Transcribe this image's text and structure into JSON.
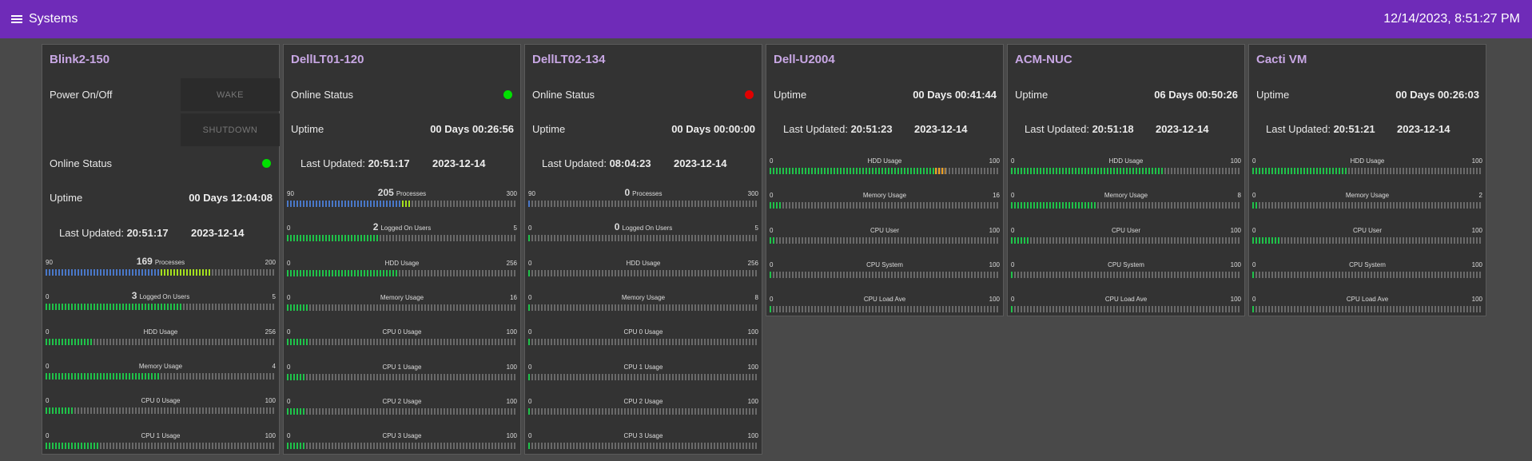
{
  "header": {
    "title": "Systems",
    "datetime": "12/14/2023, 8:51:27 PM",
    "menu_icon": "hamburger-menu-icon"
  },
  "colors": {
    "header_bg": "#6f2bb8",
    "card_bg": "#333333",
    "title": "#c8a7e4",
    "online_green": "#00e000",
    "offline_red": "#e00000",
    "bar_green": "#1fc34a",
    "bar_blue": "#4a78c8",
    "bar_lime": "#a5e01e",
    "bar_orange": "#f0a020"
  },
  "cards": [
    {
      "name": "Blink2-150",
      "power_label": "Power On/Off",
      "wake_label": "WAKE",
      "shutdown_label": "SHUTDOWN",
      "online_label": "Online Status",
      "online": true,
      "uptime_label": "Uptime",
      "uptime": "00 Days 12:04:08",
      "last_updated_label": "Last Updated:",
      "last_updated_time": "20:51:17",
      "last_updated_date": "2023-12-14",
      "gauges": [
        {
          "title": "Processes",
          "value_text": "169",
          "min": "90",
          "max": "200",
          "value": 169,
          "lo": 90,
          "hi": 200,
          "style": "process"
        },
        {
          "title": "Logged On Users",
          "value_text": "3",
          "min": "0",
          "max": "5",
          "value": 3,
          "lo": 0,
          "hi": 5,
          "style": "green"
        },
        {
          "title": "HDD Usage",
          "min": "0",
          "max": "256",
          "value": 52,
          "lo": 0,
          "hi": 256,
          "style": "green"
        },
        {
          "title": "Memory Usage",
          "min": "0",
          "max": "4",
          "value": 2.0,
          "lo": 0,
          "hi": 4,
          "style": "green"
        },
        {
          "title": "CPU 0 Usage",
          "min": "0",
          "max": "100",
          "value": 12,
          "lo": 0,
          "hi": 100,
          "style": "green"
        },
        {
          "title": "CPU 1 Usage",
          "min": "0",
          "max": "100",
          "value": 24,
          "lo": 0,
          "hi": 100,
          "style": "green"
        }
      ]
    },
    {
      "name": "DellLT01-120",
      "online_label": "Online Status",
      "online": true,
      "uptime_label": "Uptime",
      "uptime": "00 Days 00:26:56",
      "last_updated_label": "Last Updated:",
      "last_updated_time": "20:51:17",
      "last_updated_date": "2023-12-14",
      "gauges": [
        {
          "title": "Processes",
          "value_text": "205",
          "min": "90",
          "max": "300",
          "value": 205,
          "lo": 90,
          "hi": 300,
          "style": "process"
        },
        {
          "title": "Logged On Users",
          "value_text": "2",
          "min": "0",
          "max": "5",
          "value": 2,
          "lo": 0,
          "hi": 5,
          "style": "green"
        },
        {
          "title": "HDD Usage",
          "min": "0",
          "max": "256",
          "value": 125,
          "lo": 0,
          "hi": 256,
          "style": "green"
        },
        {
          "title": "Memory Usage",
          "min": "0",
          "max": "16",
          "value": 1.5,
          "lo": 0,
          "hi": 16,
          "style": "green"
        },
        {
          "title": "CPU 0 Usage",
          "min": "0",
          "max": "100",
          "value": 10,
          "lo": 0,
          "hi": 100,
          "style": "green"
        },
        {
          "title": "CPU 1 Usage",
          "min": "0",
          "max": "100",
          "value": 9,
          "lo": 0,
          "hi": 100,
          "style": "green"
        },
        {
          "title": "CPU 2 Usage",
          "min": "0",
          "max": "100",
          "value": 9,
          "lo": 0,
          "hi": 100,
          "style": "green"
        },
        {
          "title": "CPU 3 Usage",
          "min": "0",
          "max": "100",
          "value": 9,
          "lo": 0,
          "hi": 100,
          "style": "green"
        }
      ]
    },
    {
      "name": "DellLT02-134",
      "online_label": "Online Status",
      "online": false,
      "uptime_label": "Uptime",
      "uptime": "00 Days 00:00:00",
      "last_updated_label": "Last Updated:",
      "last_updated_time": "08:04:23",
      "last_updated_date": "2023-12-14",
      "gauges": [
        {
          "title": "Processes",
          "value_text": "0",
          "min": "90",
          "max": "300",
          "value": 0,
          "lo": 90,
          "hi": 300,
          "style": "process"
        },
        {
          "title": "Logged On Users",
          "value_text": "0",
          "min": "0",
          "max": "5",
          "value": 0,
          "lo": 0,
          "hi": 5,
          "style": "green"
        },
        {
          "title": "HDD Usage",
          "min": "0",
          "max": "256",
          "value": 0,
          "lo": 0,
          "hi": 256,
          "style": "green"
        },
        {
          "title": "Memory Usage",
          "min": "0",
          "max": "8",
          "value": 0,
          "lo": 0,
          "hi": 8,
          "style": "green"
        },
        {
          "title": "CPU 0 Usage",
          "min": "0",
          "max": "100",
          "value": 0,
          "lo": 0,
          "hi": 100,
          "style": "green"
        },
        {
          "title": "CPU 1 Usage",
          "min": "0",
          "max": "100",
          "value": 0,
          "lo": 0,
          "hi": 100,
          "style": "green"
        },
        {
          "title": "CPU 2 Usage",
          "min": "0",
          "max": "100",
          "value": 0,
          "lo": 0,
          "hi": 100,
          "style": "green"
        },
        {
          "title": "CPU 3 Usage",
          "min": "0",
          "max": "100",
          "value": 0,
          "lo": 0,
          "hi": 100,
          "style": "green"
        }
      ]
    },
    {
      "name": "Dell-U2004",
      "uptime_label": "Uptime",
      "uptime": "00 Days 00:41:44",
      "last_updated_label": "Last Updated:",
      "last_updated_time": "20:51:23",
      "last_updated_date": "2023-12-14",
      "gauges": [
        {
          "title": "HDD Usage",
          "min": "0",
          "max": "100",
          "value": 76,
          "lo": 0,
          "hi": 100,
          "style": "hdd"
        },
        {
          "title": "Memory Usage",
          "min": "0",
          "max": "16",
          "value": 0.9,
          "lo": 0,
          "hi": 16,
          "style": "green"
        },
        {
          "title": "CPU User",
          "min": "0",
          "max": "100",
          "value": 3,
          "lo": 0,
          "hi": 100,
          "style": "green"
        },
        {
          "title": "CPU System",
          "min": "0",
          "max": "100",
          "value": 1,
          "lo": 0,
          "hi": 100,
          "style": "green"
        },
        {
          "title": "CPU Load Ave",
          "min": "0",
          "max": "100",
          "value": 1,
          "lo": 0,
          "hi": 100,
          "style": "green"
        }
      ]
    },
    {
      "name": "ACM-NUC",
      "uptime_label": "Uptime",
      "uptime": "06 Days 00:50:26",
      "last_updated_label": "Last Updated:",
      "last_updated_time": "20:51:18",
      "last_updated_date": "2023-12-14",
      "gauges": [
        {
          "title": "HDD Usage",
          "min": "0",
          "max": "100",
          "value": 67,
          "lo": 0,
          "hi": 100,
          "style": "green"
        },
        {
          "title": "Memory Usage",
          "min": "0",
          "max": "8",
          "value": 3.0,
          "lo": 0,
          "hi": 8,
          "style": "green"
        },
        {
          "title": "CPU User",
          "min": "0",
          "max": "100",
          "value": 8,
          "lo": 0,
          "hi": 100,
          "style": "green"
        },
        {
          "title": "CPU System",
          "min": "0",
          "max": "100",
          "value": 1,
          "lo": 0,
          "hi": 100,
          "style": "green"
        },
        {
          "title": "CPU Load Ave",
          "min": "0",
          "max": "100",
          "value": 1,
          "lo": 0,
          "hi": 100,
          "style": "green"
        }
      ]
    },
    {
      "name": "Cacti VM",
      "uptime_label": "Uptime",
      "uptime": "00 Days 00:26:03",
      "last_updated_label": "Last Updated:",
      "last_updated_time": "20:51:21",
      "last_updated_date": "2023-12-14",
      "gauges": [
        {
          "title": "HDD Usage",
          "min": "0",
          "max": "100",
          "value": 42,
          "lo": 0,
          "hi": 100,
          "style": "green"
        },
        {
          "title": "Memory Usage",
          "min": "0",
          "max": "2",
          "value": 0.05,
          "lo": 0,
          "hi": 2,
          "style": "green"
        },
        {
          "title": "CPU User",
          "min": "0",
          "max": "100",
          "value": 12,
          "lo": 0,
          "hi": 100,
          "style": "green"
        },
        {
          "title": "CPU System",
          "min": "0",
          "max": "100",
          "value": 1,
          "lo": 0,
          "hi": 100,
          "style": "green"
        },
        {
          "title": "CPU Load Ave",
          "min": "0",
          "max": "100",
          "value": 1,
          "lo": 0,
          "hi": 100,
          "style": "green"
        }
      ]
    }
  ]
}
